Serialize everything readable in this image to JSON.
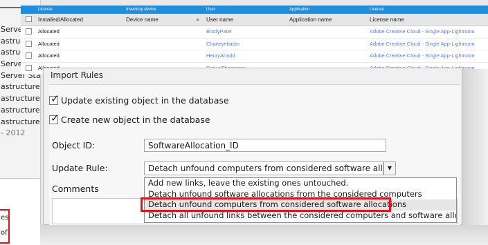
{
  "left_panel": {
    "rows": [
      "Serve",
      "astruc",
      "astruc",
      "Serve",
      "Server Stand",
      "astructure Se",
      "astructure Se",
      "astructure Se",
      "astructure Se",
      "- 2012"
    ],
    "lower_items": [
      "es",
      "of"
    ],
    "highlight_color": "#e0141e"
  },
  "grid": {
    "header_color": "#1e8fe0",
    "groups": [
      "License",
      "Inventory device",
      "User",
      "Application",
      "License"
    ],
    "columns": [
      "Installed/Allocated",
      "Device name",
      "User name",
      "Application name",
      "License name"
    ],
    "sort_icon": "sort-ascending-icon",
    "rows": [
      {
        "status": "Allocated",
        "device": "",
        "user": "BrodyPatel",
        "application": "",
        "license": "Adobe Creative Cloud - Single App-Lightroom"
      },
      {
        "status": "Allocated",
        "device": "",
        "user": "ChaneyHardin",
        "application": "",
        "license": "Adobe Creative Cloud - Single App-Lightroom"
      },
      {
        "status": "Allocated",
        "device": "",
        "user": "HenryArnold",
        "application": "",
        "license": "Adobe Creative Cloud - Single App-Lightroom"
      },
      {
        "status": "Allocated",
        "device": "",
        "user": "DariusThompson",
        "application": "",
        "license": "Adobe Creative Cloud - Single App-Lightroom"
      }
    ]
  },
  "dialog": {
    "title": "Import Rules",
    "update_existing": {
      "label": "Update existing object in the database",
      "checked": true
    },
    "create_new": {
      "label": "Create new object in the database",
      "checked": true
    },
    "object_id": {
      "label": "Object ID:",
      "value": "SoftwareAllocation_ID"
    },
    "update_rule": {
      "label": "Update Rule:",
      "selected": "Detach unfound computers from considered software alloca...",
      "button_icon": "dropdown-arrow-icon"
    },
    "comments": {
      "label": "Comments"
    },
    "dropdown_options": [
      "Add new links, leave the existing ones untouched.",
      "Detach unfound software allocations from the considered computers",
      "Detach unfound computers from considered software allocations",
      "Detach all unfound links between the considered computers and software allocations"
    ],
    "highlighted_option_index": 2
  }
}
